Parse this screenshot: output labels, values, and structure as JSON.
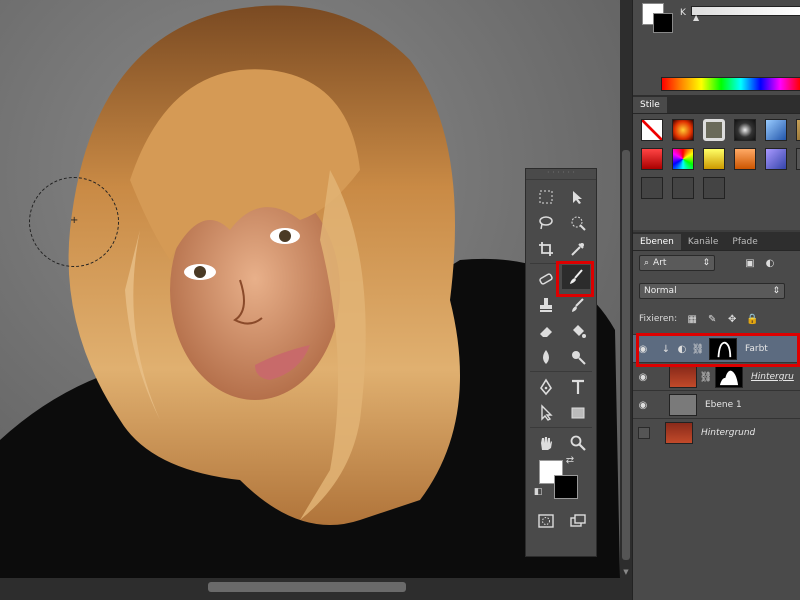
{
  "color_panel": {
    "channel_label": "K",
    "foreground": "#ffffff",
    "background": "#000000"
  },
  "styles_panel": {
    "tab_label": "Stile",
    "swatches": [
      "none-icon",
      "red-glow",
      "outline-box",
      "chrome-ball",
      "blue-cube",
      "gold-texture",
      "red-button",
      "color-pixels",
      "yellow-button",
      "orange-gradient",
      "purple-button",
      "dark-gray",
      "empty",
      "empty",
      "empty"
    ]
  },
  "layers_panel": {
    "tabs": [
      "Ebenen",
      "Kanäle",
      "Pfade"
    ],
    "filter_label": "Art",
    "blend_mode": "Normal",
    "lock_label": "Fixieren:",
    "layers": [
      {
        "name": "Farbt",
        "selected": true,
        "visible": true
      },
      {
        "name": "Hintergru",
        "selected": false,
        "visible": true
      },
      {
        "name": "Ebene 1",
        "selected": false,
        "visible": true
      },
      {
        "name": "Hintergrund",
        "selected": false,
        "visible": false
      }
    ]
  },
  "tools": {
    "active_tool": "brush-tool",
    "foreground_color": "#ffffff",
    "background_color": "#000000"
  },
  "colors": {
    "highlight": "#dd0000",
    "panel_bg": "#4a4a4a",
    "selected_layer": "#5c6b80"
  }
}
